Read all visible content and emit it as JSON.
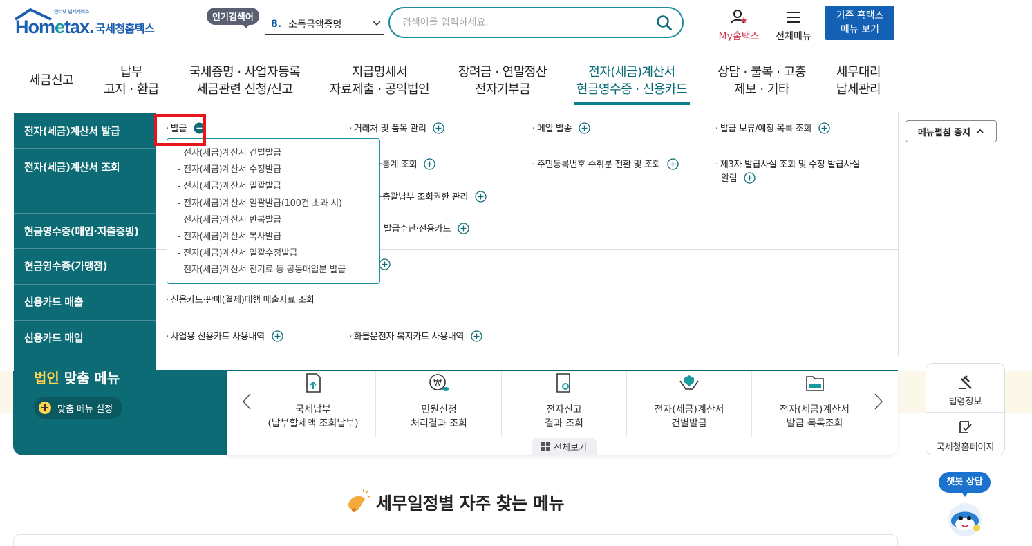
{
  "header": {
    "logo_sub": "인터넷 납세서비스",
    "logo_word_home": "Hom",
    "logo_word_e": "e",
    "logo_word_tax": "tax.",
    "logo_kr": "국세청홈택스",
    "popular_tag": "인기검색어",
    "popular_num": "8.",
    "popular_term": "소득금액증명",
    "search_placeholder": "검색어를 입력하세요.",
    "my_hometax_prefix": "My",
    "my_hometax_suffix": "홈택스",
    "all_menu": "전체메뉴",
    "old_site_line1": "기존 홈택스",
    "old_site_line2": "메뉴 보기"
  },
  "gnb": [
    {
      "line1": "세금신고",
      "line2": ""
    },
    {
      "line1": "납부",
      "line2": "고지 · 환급"
    },
    {
      "line1": "국세증명 · 사업자등록",
      "line2": "세금관련 신청/신고"
    },
    {
      "line1": "지급명세서",
      "line2": "자료제출 · 공익법인"
    },
    {
      "line1": "장려금 · 연말정산",
      "line2": "전자기부금"
    },
    {
      "line1": "전자(세금)계산서",
      "line2": "현금영수증 · 신용카드"
    },
    {
      "line1": "상담 · 불복 · 고충",
      "line2": "제보 · 기타"
    },
    {
      "line1": "세무대리",
      "line2": "납세관리"
    }
  ],
  "mega": {
    "categories": [
      "전자(세금)계산서 발급",
      "전자(세금)계산서 조회",
      "현금영수증(매입·지출증빙)",
      "현금영수증(가맹점)",
      "신용카드 매출",
      "신용카드 매입"
    ],
    "items": {
      "issue": "발급",
      "partner_items": "거래처 및 품목 관리",
      "mail_send": "메일 발송",
      "hold_list": "발급 보류/예정 목록 조회",
      "stats": "·통계 조회",
      "rrn_query": "주민등록번호 수취분 전환 및 조회",
      "third_party_line1": "제3자 발급사실 조회 및 수정 발급사실",
      "third_party_line2": "알림",
      "consolidated": "·총괄납부 조회권한 관리",
      "payment_card": "발급수단·전용카드",
      "card_sales": "신용카드·판매(결제)대행 매출자료 조회",
      "biz_card": "사업용 신용카드 사용내역",
      "cargo_card": "화물운전자 복지카드 사용내역"
    },
    "dropdown": [
      "전자(세금)계산서 건별발급",
      "전자(세금)계산서 수정발급",
      "전자(세금)계산서 일괄발급",
      "전자(세금)계산서 일괄발급(100건 초과 시)",
      "전자(세금)계산서 반복발급",
      "전자(세금)계산서 복사발급",
      "전자(세금)계산서 일괄수정발급",
      "전자(세금)계산서 전기료 등 공동매입분 발급"
    ],
    "stop_button": "메뉴펼침 중지"
  },
  "below": {
    "biz_title_a": "법인",
    "biz_title_b": " 맞춤 메뉴",
    "fit_menu_button": "맞춤 메뉴 설정",
    "quick": [
      {
        "line1": "국세납부",
        "line2": "(납부할세액 조회납부)"
      },
      {
        "line1": "민원신청",
        "line2": "처리결과 조회"
      },
      {
        "line1": "전자신고",
        "line2": "결과 조회"
      },
      {
        "line1": "전자(세금)계산서",
        "line2": "건별발급"
      },
      {
        "line1": "전자(세금)계산서",
        "line2": "발급 목록조회"
      }
    ],
    "all_view": "전체보기",
    "tools": [
      "법령정보",
      "국세청홈페이지"
    ],
    "chat": "챗봇 상담",
    "section_title": "세무일정별 자주 찾는 메뉴"
  },
  "colors": {
    "teal": "#0d6b75",
    "blue": "#1460b4",
    "highlight": "#e8141b",
    "pink": "#d63a55"
  }
}
